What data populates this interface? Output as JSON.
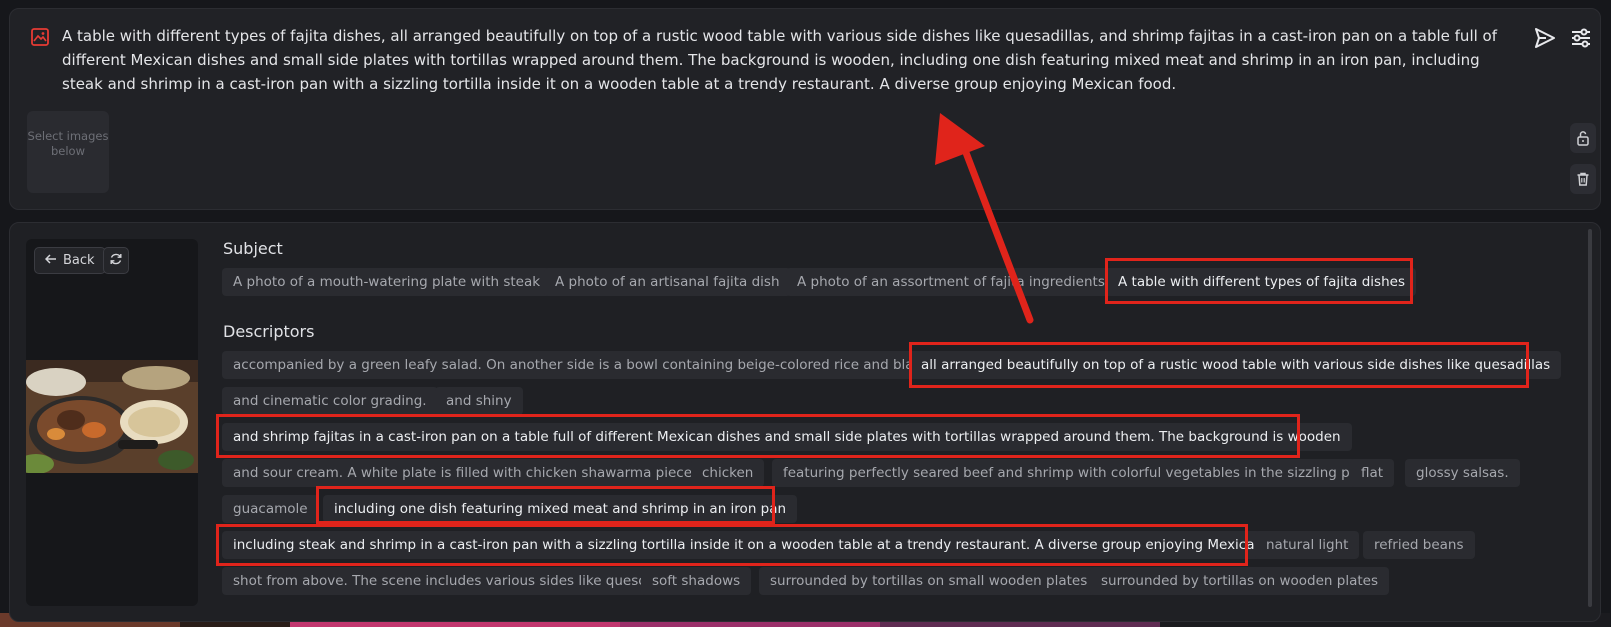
{
  "prompt": {
    "text": "A table with different types of fajita dishes, all arranged beautifully on top of a rustic wood table with various side dishes like quesadillas, and shrimp fajitas in a cast-iron pan on a table full of different Mexican dishes and small side plates with tortillas wrapped around them. The background is wooden, including one dish featuring mixed meat and shrimp in an iron pan, including steak and shrimp in a cast-iron pan with a sizzling tortilla inside it on a wooden table at a trendy restaurant. A diverse group enjoying Mexican food.",
    "image_slot_label": "Select images below",
    "icons": {
      "prompt": "image-icon",
      "send": "send-icon",
      "settings": "sliders-icon",
      "lock": "unlock-icon",
      "trash": "trash-icon"
    }
  },
  "builder": {
    "back_label": "Back",
    "subject_title": "Subject",
    "descriptors_title": "Descriptors",
    "subjects": [
      "A photo of a mouth-watering plate with steak",
      "A photo of an artisanal fajita dish",
      "A photo of an assortment of fajita ingredients",
      "A table with different types of fajita dishes"
    ],
    "descriptors": [
      "accompanied by a green leafy salad. On another side is a bowl containing beige-colored rice and black",
      "all arranged beautifully on top of a rustic wood table with various side dishes like quesadillas",
      "and cinematic color grading.",
      "and shiny",
      "and shrimp fajitas in a cast-iron pan on a table full of different Mexican dishes and small side plates with tortillas wrapped around them. The background is wooden",
      "and sour cream. A white plate is filled with chicken shawarma pieces",
      "chicken",
      "featuring perfectly seared beef and shrimp with colorful vegetables in the sizzling pan",
      "flat",
      "glossy salsas.",
      "guacamole",
      "including one dish featuring mixed meat and shrimp in an iron pan",
      "including steak and shrimp in a cast-iron pan with a sizzling tortilla inside it on a wooden table at a trendy restaurant. A diverse group enjoying Mexican food.",
      "natural light",
      "refried beans",
      "shot from above. The scene includes various sides like queso",
      "soft shadows",
      "surrounded by tortillas on small wooden plates",
      "surrounded by tortillas on wooden plates"
    ]
  },
  "colors": {
    "highlight": "#e0241b",
    "panel": "#212226",
    "chip": "#2a2b30"
  }
}
